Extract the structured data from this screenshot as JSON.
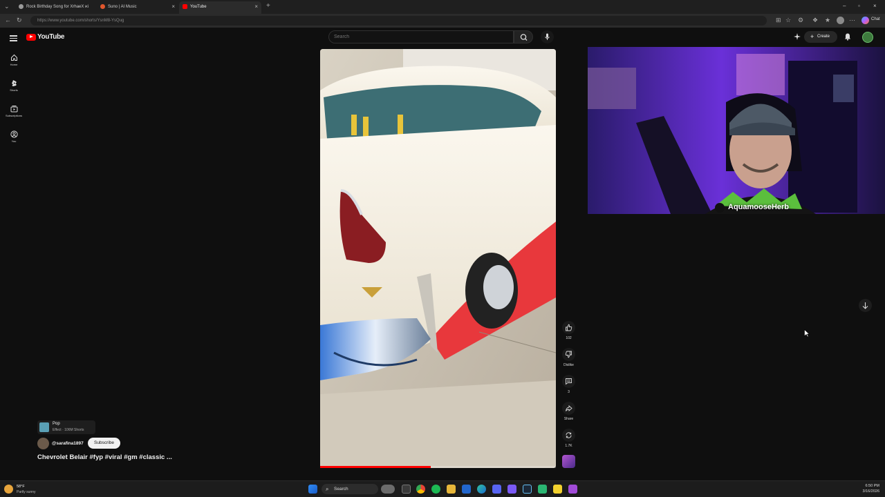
{
  "browser": {
    "tabs": [
      {
        "title": "Rock Birthday Song for XrhaeX - i"
      },
      {
        "title": "Suno | AI Music"
      },
      {
        "title": "YouTube"
      }
    ],
    "url": "https://www.youtube.com/shorts/YsnM8-YsQug",
    "chat_label": "Chat"
  },
  "youtube": {
    "logo_text": "YouTube",
    "search_placeholder": "Search",
    "create_label": "Create",
    "sidebar": [
      {
        "label": "Home",
        "icon": "home-icon"
      },
      {
        "label": "Shorts",
        "icon": "shorts-icon"
      },
      {
        "label": "Subscriptions",
        "icon": "subscriptions-icon"
      },
      {
        "label": "You",
        "icon": "you-icon"
      }
    ],
    "short": {
      "effect_name": "Pop",
      "effect_sub": "Effect · 106M Shorts",
      "channel": "@sarafina1897",
      "subscribe_label": "Subscribe",
      "title": "Chevrolet Belair #fyp #viral #gm #classic ...",
      "progress": 0.47,
      "actions": [
        {
          "label": "102",
          "icon": "like-icon"
        },
        {
          "label": "Dislike",
          "icon": "dislike-icon"
        },
        {
          "label": "3",
          "icon": "comment-icon"
        },
        {
          "label": "Share",
          "icon": "share-icon"
        },
        {
          "label": "1.7K",
          "icon": "remix-icon"
        }
      ]
    }
  },
  "overlay": {
    "streamer_name": "AquamooseHerb"
  },
  "taskbar": {
    "temperature": "58°F",
    "weather": "Partly sunny",
    "search_label": "Search",
    "time": "6:50 PM",
    "date": "3/16/2026"
  },
  "colors": {
    "yt_red": "#ff0000",
    "bg": "#0f0f0f",
    "car_red": "#e8383c",
    "car_cream": "#f1ebdd",
    "stream_purple": "#5a2bd6"
  }
}
